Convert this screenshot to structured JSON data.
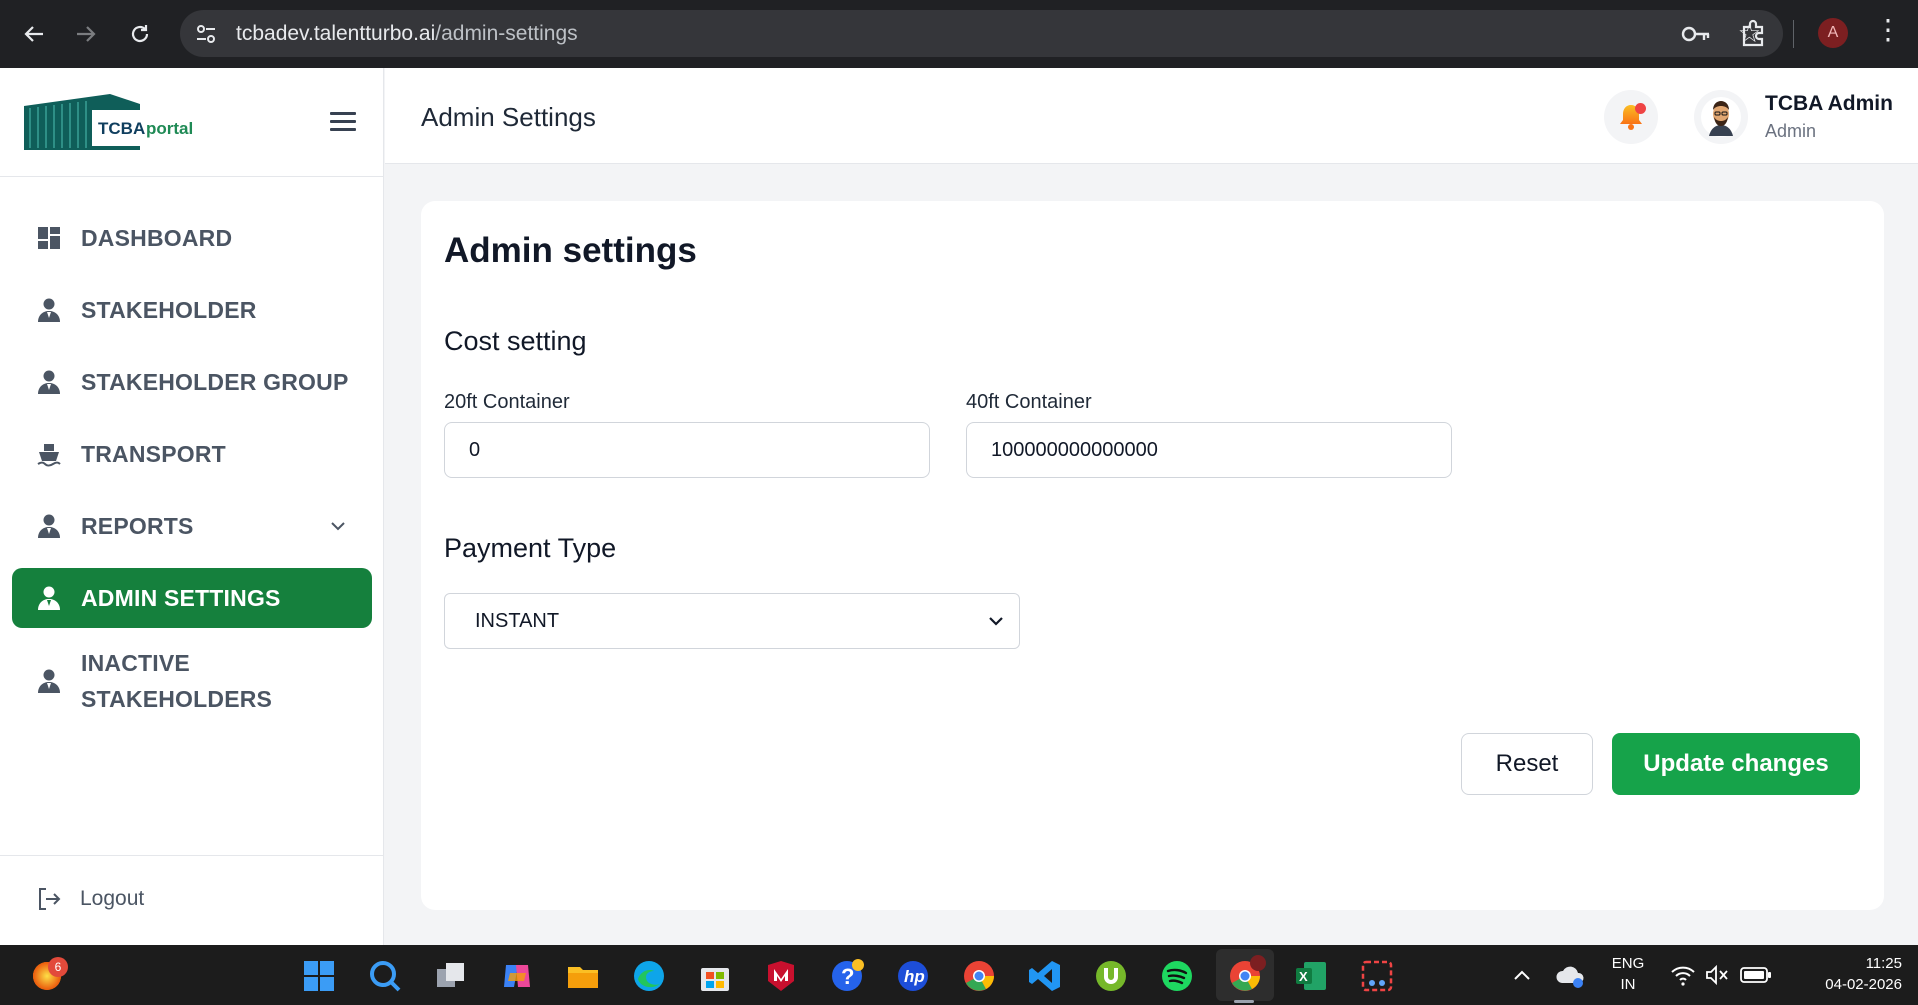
{
  "browser": {
    "url_host": "tcbadev.talentturbo.ai",
    "url_path": "/admin-settings",
    "profile_initial": "A"
  },
  "logo": {
    "text_bold": "TCBA",
    "text_regular": "portal"
  },
  "sidebar": {
    "items": [
      {
        "label": "DASHBOARD",
        "icon": "dashboard-icon"
      },
      {
        "label": "STAKEHOLDER",
        "icon": "user-icon"
      },
      {
        "label": "STAKEHOLDER GROUP",
        "icon": "user-icon"
      },
      {
        "label": "TRANSPORT",
        "icon": "ship-icon"
      },
      {
        "label": "REPORTS",
        "icon": "user-icon"
      },
      {
        "label": "ADMIN SETTINGS",
        "icon": "user-icon",
        "active": true
      },
      {
        "label_line1": "INACTIVE",
        "label_line2": "STAKEHOLDERS",
        "icon": "user-icon"
      }
    ],
    "logout_label": "Logout"
  },
  "header": {
    "title": "Admin Settings",
    "user_name": "TCBA Admin",
    "user_role": "Admin"
  },
  "main": {
    "title": "Admin settings",
    "cost_section": "Cost setting",
    "field_20ft_label": "20ft Container",
    "field_20ft_value": "0",
    "field_40ft_label": "40ft Container",
    "field_40ft_value": "100000000000000",
    "payment_section": "Payment Type",
    "payment_selected": "INSTANT",
    "reset_label": "Reset",
    "update_label": "Update changes"
  },
  "taskbar": {
    "notification_count": "6",
    "lang_line1": "ENG",
    "lang_line2": "IN",
    "time": "11:25",
    "date": "04-02-2026"
  },
  "colors": {
    "accent": "#15803d",
    "button_green": "#16a34a",
    "notification_dot": "#ef4444"
  }
}
